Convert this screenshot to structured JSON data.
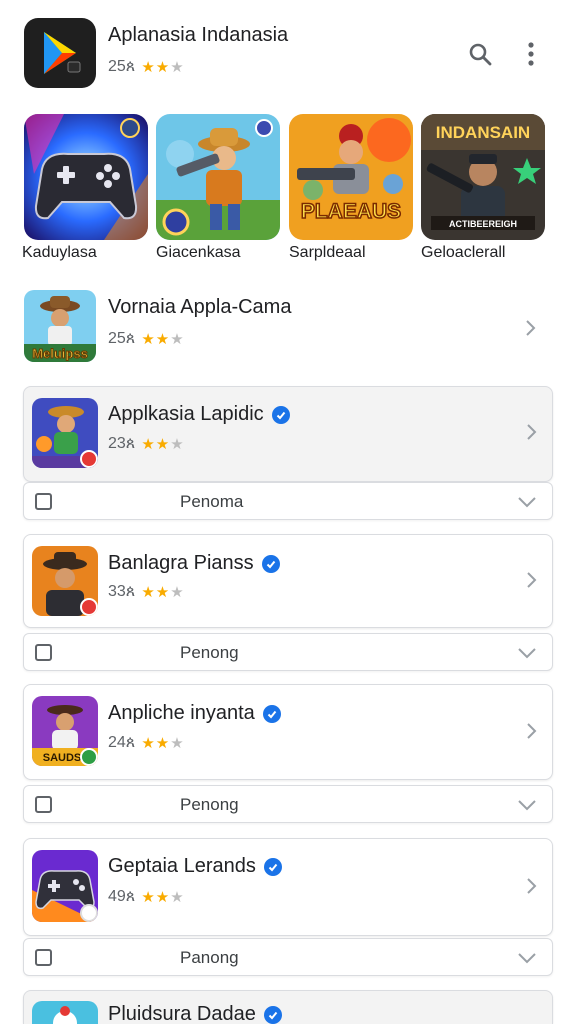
{
  "header": {
    "title": "Aplanasia Indanasia",
    "rating_text": "25ጰ",
    "stars_filled": 2,
    "stars_total": 3
  },
  "featured": [
    {
      "label": "Kaduylasa",
      "icon": "gamepad-icon"
    },
    {
      "label": "Giacenkasa",
      "icon": "cowboy-gunner-art"
    },
    {
      "label": "Sarpldeaal",
      "icon": "gunner-art",
      "tile_text": "PLAEAUS"
    },
    {
      "label": "Geloaclerall",
      "icon": "soldier-art",
      "tile_text": "INDANSAIN",
      "tile_subtext": "ACTIBEEREIGH"
    }
  ],
  "list_item": {
    "title": "Vornaia Appla-Cama",
    "rating_text": "25ጰ",
    "badge_text": "Meluipss"
  },
  "cards": [
    {
      "title": "Applkasia Lapidic",
      "rating_text": "23ጰ",
      "footer_label": "Penoma"
    },
    {
      "title": "Banlagra Pianss",
      "rating_text": "33ጰ",
      "footer_label": "Penong"
    },
    {
      "title": "Anpliche inyanta",
      "rating_text": "24ጰ",
      "footer_label": "Penong",
      "thumb_text": "SAUDS"
    },
    {
      "title": "Geptaia Lerands",
      "rating_text": "49ጰ",
      "footer_label": "Panong"
    },
    {
      "title": "Pluidsura Dadae"
    }
  ],
  "colors": {
    "star": "#f9ab00",
    "verified": "#1a73e8",
    "border": "#dadce0"
  }
}
